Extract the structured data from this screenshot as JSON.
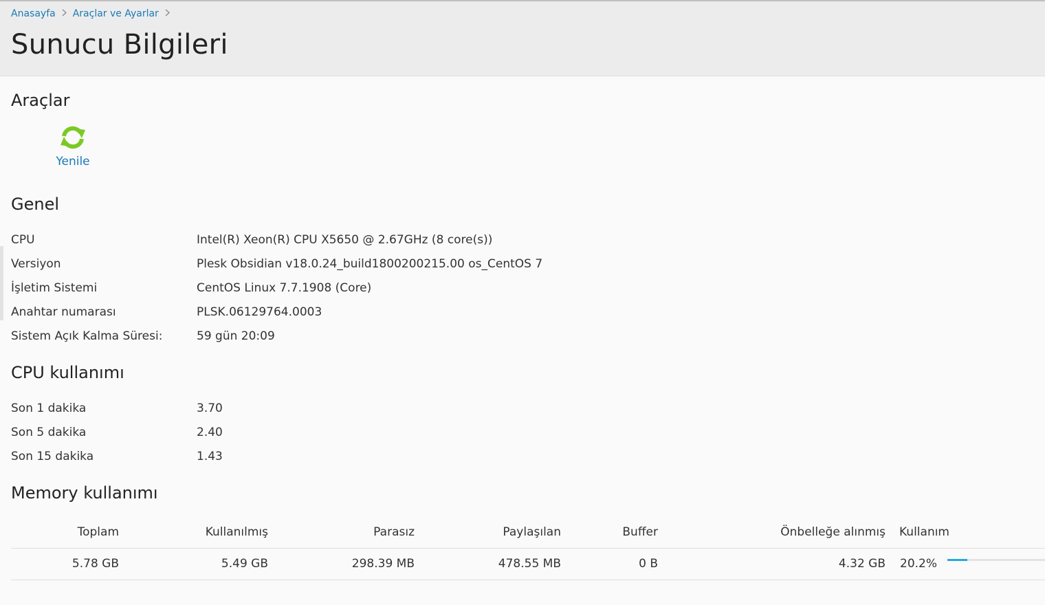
{
  "breadcrumb": {
    "items": [
      "Anasayfa",
      "Araçlar ve Ayarlar"
    ]
  },
  "page": {
    "title": "Sunucu Bilgileri"
  },
  "tools": {
    "title": "Araçlar",
    "refresh_label": "Yenile",
    "refresh_icon": "refresh-icon"
  },
  "general": {
    "title": "Genel",
    "rows": [
      {
        "label": "CPU",
        "value": "Intel(R) Xeon(R) CPU X5650 @ 2.67GHz (8 core(s))"
      },
      {
        "label": "Versiyon",
        "value": "Plesk Obsidian v18.0.24_build1800200215.00 os_CentOS 7"
      },
      {
        "label": "İşletim Sistemi",
        "value": "CentOS Linux 7.7.1908 (Core)"
      },
      {
        "label": "Anahtar numarası",
        "value": "PLSK.06129764.0003"
      },
      {
        "label": "Sistem Açık Kalma Süresi:",
        "value": "59 gün 20:09"
      }
    ]
  },
  "cpu": {
    "title": "CPU kullanımı",
    "rows": [
      {
        "label": "Son 1 dakika",
        "value": "3.70"
      },
      {
        "label": "Son 5 dakika",
        "value": "2.40"
      },
      {
        "label": "Son 15 dakika",
        "value": "1.43"
      }
    ]
  },
  "memory": {
    "title": "Memory kullanımı",
    "headers": {
      "total": "Toplam",
      "used": "Kullanılmış",
      "free": "Parasız",
      "shared": "Paylaşılan",
      "buffer": "Buffer",
      "cached": "Önbelleğe alınmış",
      "usage": "Kullanım"
    },
    "values": {
      "total": "5.78 GB",
      "used": "5.49 GB",
      "free": "298.39 MB",
      "shared": "478.55 MB",
      "buffer": "0 B",
      "cached": "4.32 GB",
      "usage": "20.2%"
    },
    "usage_fraction": 0.202,
    "bar_color": "#28a8e0"
  },
  "colors": {
    "link": "#1a7ab5",
    "refresh_icon": "#7cc924"
  }
}
